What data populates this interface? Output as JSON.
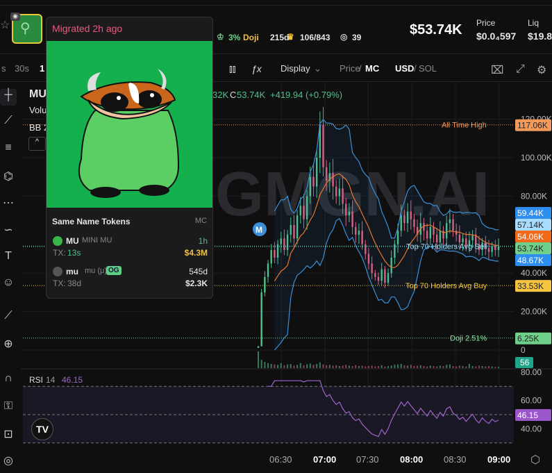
{
  "header": {
    "token_name_partial": "MU",
    "doji_pct": "3%",
    "doji_label": "Doji",
    "doji_age": "215d",
    "holders": "106/843",
    "watchers": "39",
    "market_cap": "$53.74K",
    "price_label": "Price",
    "price_value": "$0.0₄597",
    "liq_label": "Liq",
    "liq_value": "$19.8"
  },
  "toolbar": {
    "intervals": [
      "s",
      "30s",
      "1"
    ],
    "display": "Display",
    "price": "Price",
    "mc": "MC",
    "usd": "USD",
    "sol": "SOL",
    "sep": "/"
  },
  "legend": {
    "symbol": "MU",
    "volume": "Volu",
    "bb": "BB 2",
    "ohlc_tail": "32K",
    "close_label": "C",
    "close": "53.74K",
    "change": "+419.94 (+0.79%)"
  },
  "watermark": "GMGN.AI",
  "popup": {
    "migrated": "Migrated 2h ago",
    "section_title": "Same Name Tokens",
    "mc_header": "MC",
    "tokens": [
      {
        "symbol": "MU",
        "name": "MINI MU",
        "age": "1h",
        "tx_label": "TX:",
        "tx": "13s",
        "mc": "$4.3M",
        "badge": ""
      },
      {
        "symbol": "mu",
        "name": "mu (μ)",
        "age": "545d",
        "tx_label": "TX:",
        "tx": "38d",
        "mc": "$2.3K",
        "badge": "OG"
      }
    ]
  },
  "price_axis": {
    "ticks": [
      "120.00K",
      "100.00K",
      "80.00K",
      "40.00K",
      "20.00K",
      "0"
    ],
    "tick_values": [
      120,
      100,
      80,
      40,
      20,
      0
    ]
  },
  "markers": {
    "ath_label": "All Time High",
    "ath": "117.06K",
    "sell_label": "Top 70 Holders Avg Sell",
    "sell": "54.06K",
    "buy_label": "Top 70 Holders Avg Buy",
    "buy": "33.53K",
    "doji_label": "Doji 2.51%",
    "doji": "6.25K",
    "bb_upper": "59.44K",
    "bb_basis": "57.14K",
    "bb_lower": "48.67K",
    "last": "53.74K",
    "volume": "56",
    "migration_marker": "M",
    "values": {
      "ath": 117.06,
      "sell": 54.06,
      "buy": 33.53,
      "doji": 6.25,
      "upper": 59.44,
      "basis": 57.14,
      "lower": 48.67,
      "last": 53.74
    }
  },
  "rsi": {
    "label": "RSI",
    "period": "14",
    "value": "46.15",
    "ticks": [
      "80.00",
      "60.00",
      "40.00"
    ],
    "tick_values": [
      80,
      60,
      40
    ],
    "levels": [
      70,
      50,
      30
    ]
  },
  "time_axis": {
    "ticks": [
      "06:30",
      "07:00",
      "07:30",
      "08:00",
      "08:30",
      "09:00"
    ],
    "bold": [
      false,
      true,
      false,
      true,
      false,
      true
    ]
  },
  "colors": {
    "up": "#4fc28a",
    "down": "#e0607e",
    "bb": "#3b8fd9",
    "basis": "#e8772e",
    "ath": "#f39a5b",
    "buy": "#f5c542",
    "rsi": "#a065d0"
  },
  "series": {
    "closes": [
      2,
      30,
      38,
      45,
      52,
      48,
      55,
      58,
      52,
      60,
      65,
      58,
      70,
      75,
      68,
      80,
      90,
      85,
      100,
      117,
      95,
      88,
      92,
      85,
      80,
      84,
      76,
      70,
      72,
      64,
      60,
      62,
      55,
      50,
      45,
      40,
      38,
      36,
      42,
      35,
      40,
      48,
      55,
      62,
      70,
      66,
      72,
      68,
      64,
      60,
      66,
      62,
      58,
      64,
      60,
      56,
      62,
      58,
      66,
      68,
      62,
      60,
      56,
      58,
      54,
      57,
      60,
      55,
      52,
      56,
      53,
      51,
      54,
      52,
      53.74
    ],
    "volumes": [
      40,
      20,
      15,
      12,
      10,
      9,
      8,
      12,
      7,
      9,
      10,
      6,
      8,
      12,
      7,
      9,
      11,
      8,
      10,
      14,
      9,
      7,
      8,
      6,
      7,
      5,
      6,
      8,
      6,
      5,
      7,
      5,
      6,
      4,
      5,
      6,
      4,
      5,
      7,
      4,
      5,
      6,
      8,
      9,
      10,
      7,
      6,
      8,
      5,
      6,
      7,
      5,
      4,
      6,
      5,
      4,
      6,
      5,
      8,
      9,
      5,
      4,
      6,
      5,
      4,
      10,
      5,
      4,
      6,
      5,
      4,
      5,
      4,
      3,
      3
    ]
  }
}
